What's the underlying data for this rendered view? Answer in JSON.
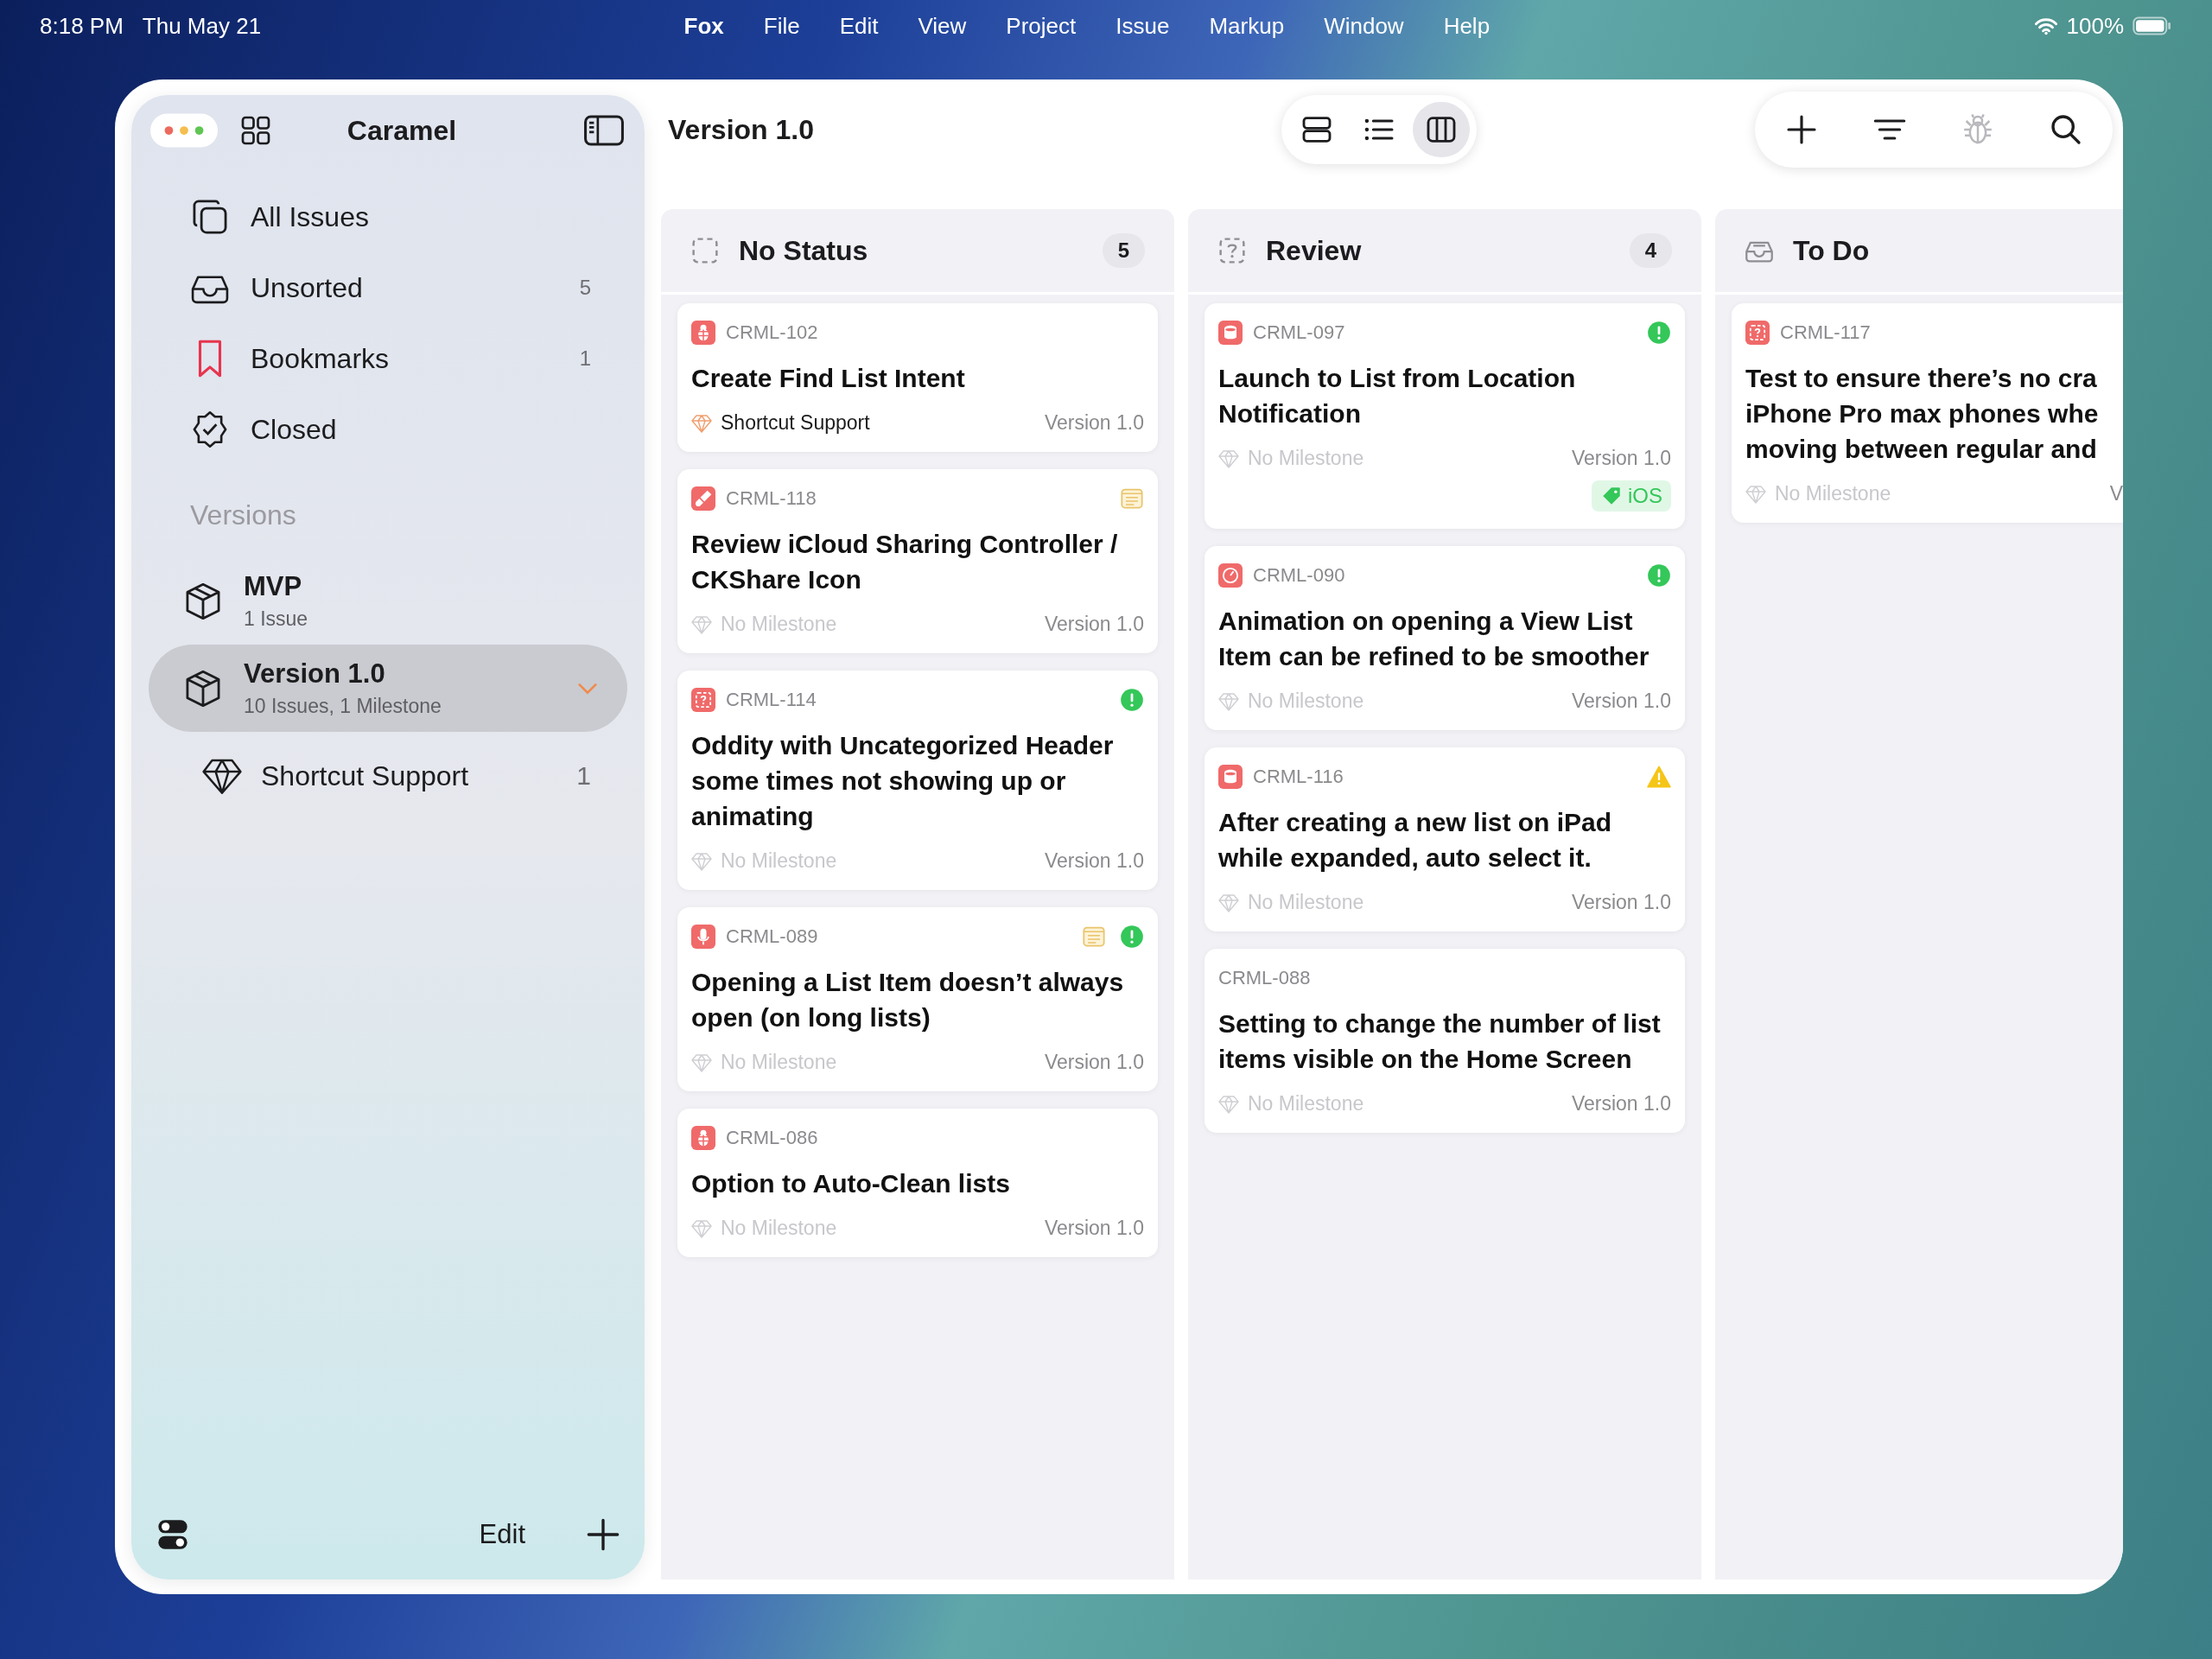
{
  "status_bar": {
    "time": "8:18 PM",
    "date": "Thu May 21",
    "battery": "100%"
  },
  "menu_bar": [
    {
      "label": "Fox",
      "kind": "app"
    },
    {
      "label": "File",
      "kind": "menu"
    },
    {
      "label": "Edit",
      "kind": "menu"
    },
    {
      "label": "View",
      "kind": "menu"
    },
    {
      "label": "Project",
      "kind": "menu"
    },
    {
      "label": "Issue",
      "kind": "menu"
    },
    {
      "label": "Markup",
      "kind": "menu"
    },
    {
      "label": "Window",
      "kind": "menu"
    },
    {
      "label": "Help",
      "kind": "menu"
    }
  ],
  "sidebar": {
    "title": "Caramel",
    "items": [
      {
        "kind": "all",
        "label": "All Issues"
      },
      {
        "kind": "unsorted",
        "label": "Unsorted",
        "count": "5"
      },
      {
        "kind": "bookmarks",
        "label": "Bookmarks",
        "count": "1"
      },
      {
        "kind": "closed",
        "label": "Closed"
      }
    ],
    "versions_header": "Versions",
    "versions": [
      {
        "title": "MVP",
        "subtitle": "1 Issue",
        "selected": false,
        "expanded": false
      },
      {
        "title": "Version 1.0",
        "subtitle": "10 Issues, 1 Milestone",
        "selected": true,
        "expanded": true,
        "children": [
          {
            "label": "Shortcut Support",
            "count": "1"
          }
        ]
      }
    ],
    "edit": "Edit"
  },
  "toolbar": {
    "title": "Version 1.0",
    "views": [
      {
        "kind": "rows",
        "selected": false
      },
      {
        "kind": "list",
        "selected": false
      },
      {
        "kind": "columns",
        "selected": true
      }
    ],
    "actions": [
      {
        "kind": "add",
        "disabled": false
      },
      {
        "kind": "filter",
        "disabled": false
      },
      {
        "kind": "bug",
        "disabled": true
      },
      {
        "kind": "search",
        "disabled": false
      }
    ]
  },
  "columns": [
    {
      "kind": "none",
      "title": "No Status",
      "count": "5",
      "cards": [
        {
          "id": "CRML-102",
          "kind": "bug",
          "title": "Create Find List Intent",
          "milestone": "Shortcut Support",
          "milestone_set": true,
          "version": "Version 1.0",
          "note": false,
          "priority": false,
          "warning": false
        },
        {
          "id": "CRML-118",
          "kind": "design",
          "title": "Review iCloud Sharing Controller / CKShare Icon",
          "milestone": "No Milestone",
          "milestone_set": false,
          "version": "Version 1.0",
          "note": true,
          "priority": false,
          "warning": false
        },
        {
          "id": "CRML-114",
          "kind": "question",
          "title": "Oddity with Uncategorized Header some times not showing up or animating",
          "milestone": "No Milestone",
          "milestone_set": false,
          "version": "Version 1.0",
          "note": false,
          "priority": true,
          "warning": false
        },
        {
          "id": "CRML-089",
          "kind": "device",
          "title": "Opening a List Item doesn’t always open (on long lists)",
          "milestone": "No Milestone",
          "milestone_set": false,
          "version": "Version 1.0",
          "note": true,
          "priority": true,
          "warning": false
        },
        {
          "id": "CRML-086",
          "kind": "bug",
          "title": "Option to Auto-Clean lists",
          "milestone": "No Milestone",
          "milestone_set": false,
          "version": "Version 1.0",
          "note": false,
          "priority": false,
          "warning": false
        }
      ]
    },
    {
      "kind": "review",
      "title": "Review",
      "count": "4",
      "cards": [
        {
          "id": "CRML-097",
          "kind": "crash",
          "title": "Launch to List from Location Notification",
          "milestone": "No Milestone",
          "milestone_set": false,
          "version": "Version 1.0",
          "note": false,
          "priority": true,
          "warning": false,
          "tags": [
            {
              "label": "iOS",
              "color": "#34c759"
            }
          ]
        },
        {
          "id": "CRML-090",
          "kind": "gauge",
          "title": "Animation on opening a View List Item can be refined to be smoother",
          "milestone": "No Milestone",
          "milestone_set": false,
          "version": "Version 1.0",
          "note": false,
          "priority": true,
          "warning": false
        },
        {
          "id": "CRML-116",
          "kind": "crash",
          "title": "After creating a new list on iPad while expanded, auto select it.",
          "milestone": "No Milestone",
          "milestone_set": false,
          "version": "Version 1.0",
          "note": false,
          "priority": false,
          "warning": true
        },
        {
          "id": "CRML-088",
          "title": "Setting to change the number of list items visible on the Home Screen",
          "milestone": "No Milestone",
          "milestone_set": false,
          "version": "Version 1.0",
          "note": false,
          "priority": false,
          "warning": false
        }
      ]
    },
    {
      "kind": "todo",
      "title": "To Do",
      "cards": [
        {
          "id": "CRML-117",
          "kind": "question",
          "title": "Test to ensure there’s no cra\niPhone Pro max phones whe\nmoving between regular and",
          "milestone": "No Milestone",
          "milestone_set": false,
          "version": "V",
          "note": false,
          "priority": false,
          "warning": false
        }
      ]
    }
  ]
}
